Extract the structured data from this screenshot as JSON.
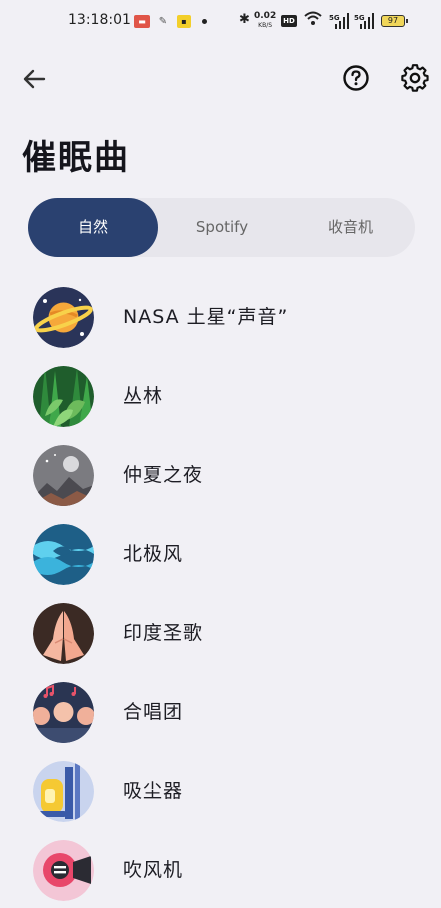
{
  "status_bar": {
    "time": "13:18:01",
    "net_speed_value": "0.02",
    "net_speed_unit": "KB/S",
    "hd_badge": "HD",
    "signal_1": "5G",
    "signal_2": "5G",
    "battery": "97"
  },
  "header": {
    "title": "催眠曲",
    "back_icon": "arrow-left-icon",
    "help_icon": "help-circle-icon",
    "settings_icon": "gear-icon"
  },
  "tabs": [
    {
      "label": "自然",
      "active": true
    },
    {
      "label": "Spotify",
      "active": false
    },
    {
      "label": "收音机",
      "active": false
    }
  ],
  "sounds": [
    {
      "label": "NASA 土星“声音”",
      "icon": "saturn-icon"
    },
    {
      "label": "丛林",
      "icon": "jungle-icon"
    },
    {
      "label": "仲夏之夜",
      "icon": "night-moon-icon"
    },
    {
      "label": "北极风",
      "icon": "arctic-wind-icon"
    },
    {
      "label": "印度圣歌",
      "icon": "praying-hands-icon"
    },
    {
      "label": "合唱团",
      "icon": "choir-icon"
    },
    {
      "label": "吸尘器",
      "icon": "vacuum-icon"
    },
    {
      "label": "吹风机",
      "icon": "hair-dryer-icon"
    }
  ],
  "colors": {
    "background": "#f1f0f5",
    "accent": "#2a4170",
    "tab_track": "#e7e6ec"
  }
}
